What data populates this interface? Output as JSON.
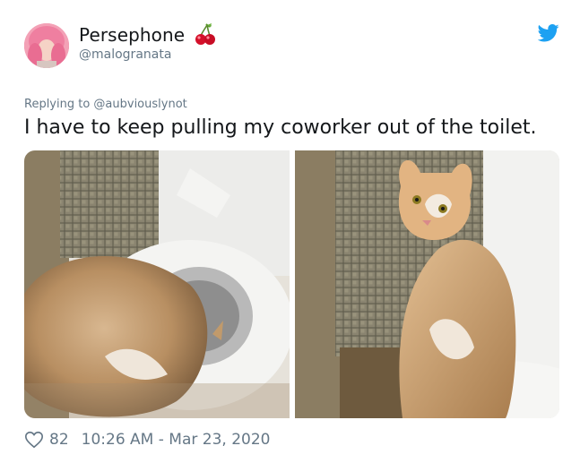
{
  "user": {
    "display_name": "Persephone",
    "handle": "@malogranata",
    "emoji_icon": "cherries"
  },
  "tweet": {
    "replying_to": "Replying to @aubviouslynot",
    "text": "I have to keep pulling my coworker out of the toilet."
  },
  "footer": {
    "likes": "82",
    "timestamp": "10:26 AM - Mar 23, 2020"
  },
  "colors": {
    "twitter_blue": "#1da1f2",
    "secondary_text": "#657786",
    "primary_text": "#14171a"
  },
  "media": [
    {
      "name": "photo-cat-in-toilet"
    },
    {
      "name": "photo-cat-looking-back"
    }
  ]
}
